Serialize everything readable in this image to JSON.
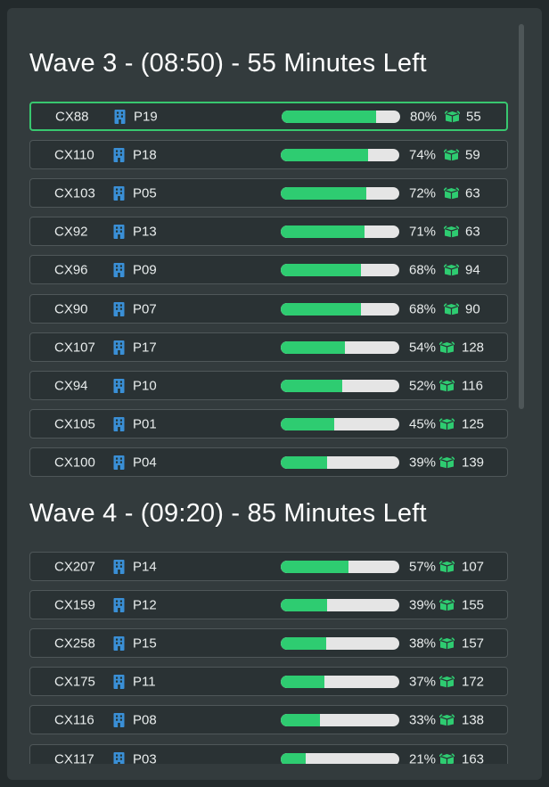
{
  "waves": [
    {
      "title": "Wave 3 - (08:50) - 55 Minutes Left",
      "rows": [
        {
          "cx": "CX88",
          "door": "P19",
          "pct_value": 80,
          "pct": "80%",
          "count": "55",
          "selected": true
        },
        {
          "cx": "CX110",
          "door": "P18",
          "pct_value": 74,
          "pct": "74%",
          "count": "59"
        },
        {
          "cx": "CX103",
          "door": "P05",
          "pct_value": 72,
          "pct": "72%",
          "count": "63"
        },
        {
          "cx": "CX92",
          "door": "P13",
          "pct_value": 71,
          "pct": "71%",
          "count": "63"
        },
        {
          "cx": "CX96",
          "door": "P09",
          "pct_value": 68,
          "pct": "68%",
          "count": "94"
        },
        {
          "cx": "CX90",
          "door": "P07",
          "pct_value": 68,
          "pct": "68%",
          "count": "90"
        },
        {
          "cx": "CX107",
          "door": "P17",
          "pct_value": 54,
          "pct": "54%",
          "count": "128"
        },
        {
          "cx": "CX94",
          "door": "P10",
          "pct_value": 52,
          "pct": "52%",
          "count": "116"
        },
        {
          "cx": "CX105",
          "door": "P01",
          "pct_value": 45,
          "pct": "45%",
          "count": "125"
        },
        {
          "cx": "CX100",
          "door": "P04",
          "pct_value": 39,
          "pct": "39%",
          "count": "139"
        }
      ]
    },
    {
      "title": "Wave 4 - (09:20) - 85 Minutes Left",
      "rows": [
        {
          "cx": "CX207",
          "door": "P14",
          "pct_value": 57,
          "pct": "57%",
          "count": "107"
        },
        {
          "cx": "CX159",
          "door": "P12",
          "pct_value": 39,
          "pct": "39%",
          "count": "155"
        },
        {
          "cx": "CX258",
          "door": "P15",
          "pct_value": 38,
          "pct": "38%",
          "count": "157"
        },
        {
          "cx": "CX175",
          "door": "P11",
          "pct_value": 37,
          "pct": "37%",
          "count": "172"
        },
        {
          "cx": "CX116",
          "door": "P08",
          "pct_value": 33,
          "pct": "33%",
          "count": "138"
        },
        {
          "cx": "CX117",
          "door": "P03",
          "pct_value": 21,
          "pct": "21%",
          "count": "163"
        }
      ]
    }
  ],
  "colors": {
    "progress_fill": "#2ecc71",
    "progress_track": "#e5e5e5",
    "building_icon": "#3a8fd6",
    "box_icon": "#2ecc71",
    "selected_border": "#38c76f"
  },
  "icons": {
    "building": "building-icon",
    "box": "box-icon"
  }
}
